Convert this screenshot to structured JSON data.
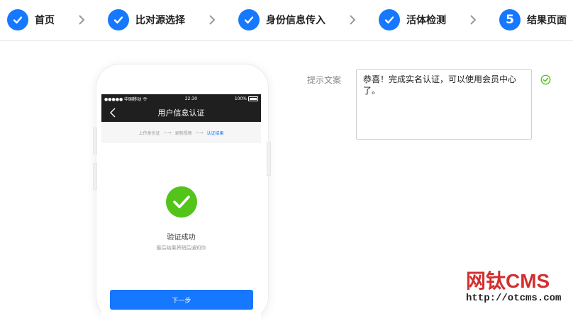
{
  "steps": [
    {
      "label": "首页",
      "state": "done"
    },
    {
      "label": "比对源选择",
      "state": "done"
    },
    {
      "label": "身份信息传入",
      "state": "done"
    },
    {
      "label": "活体检测",
      "state": "done"
    },
    {
      "label": "结果页面",
      "state": "current",
      "number": "5"
    }
  ],
  "colors": {
    "accent": "#1677ff",
    "success": "#52c41a",
    "watermark": "#d32f2f"
  },
  "phone": {
    "status": {
      "carrier": "●●●●● 中国移动",
      "time": "22:30",
      "battery": "100%"
    },
    "nav_title": "用户信息认证",
    "progress": [
      {
        "label": "上传身份证"
      },
      {
        "label": "录制视频"
      },
      {
        "label": "认证结果",
        "active": true
      }
    ],
    "progress_arrow": "—→",
    "result_title": "验证成功",
    "result_subtitle": "最后结果将稍后通知你",
    "next_button": "下一步"
  },
  "form": {
    "label": "提示文案",
    "value": "恭喜！完成实名认证，可以使用会员中心了。",
    "valid_icon": "check-circle-icon"
  },
  "watermark": {
    "title": "网钛CMS",
    "url": "http://otcms.com"
  }
}
